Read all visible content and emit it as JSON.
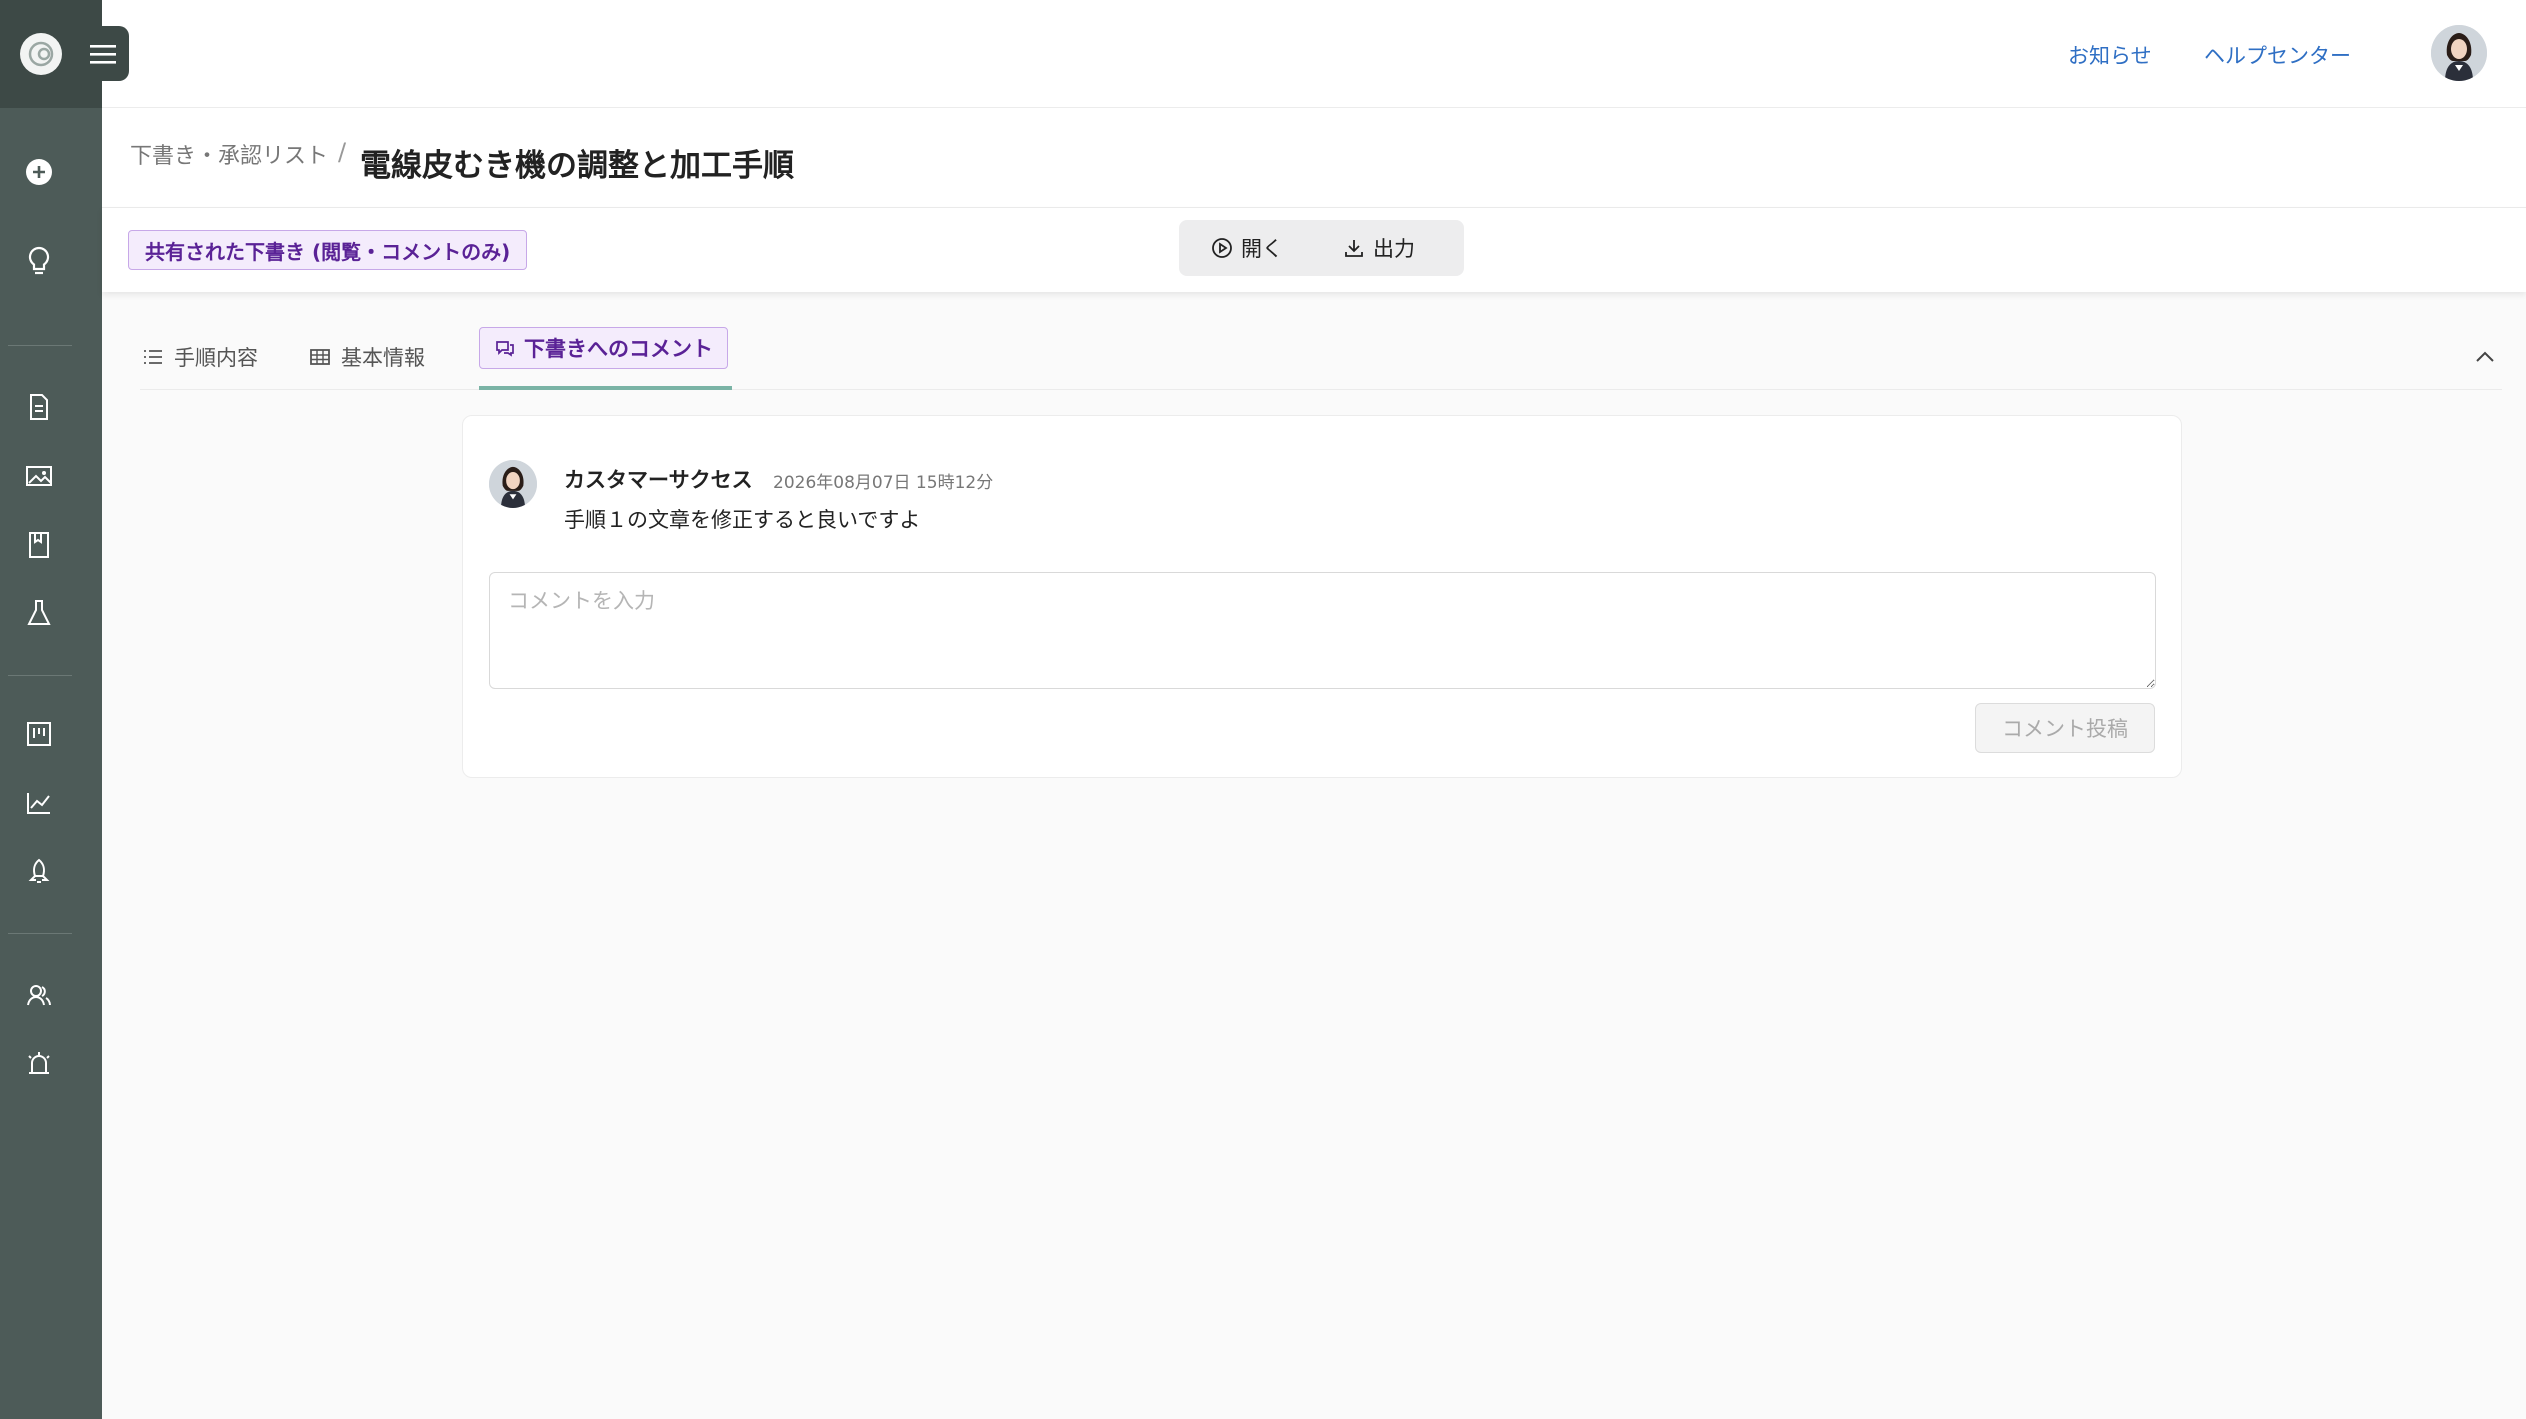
{
  "app": {
    "colors": {
      "sidebar": "#4d5b58",
      "link": "#2f6fc4",
      "badge_text": "#5a2296",
      "badge_bg": "#f4ecfc",
      "tab_underline": "#7ab3a5"
    }
  },
  "sidebar": {
    "logo_icon": "logo-icon",
    "items": [
      {
        "icon": "plus-circle-icon"
      },
      {
        "icon": "lightbulb-icon"
      },
      {
        "icon": "document-icon"
      },
      {
        "icon": "image-icon"
      },
      {
        "icon": "book-icon"
      },
      {
        "icon": "flask-icon"
      },
      {
        "icon": "board-icon"
      },
      {
        "icon": "chart-icon"
      },
      {
        "icon": "rocket-icon"
      },
      {
        "icon": "users-icon"
      },
      {
        "icon": "alarm-icon"
      }
    ]
  },
  "header": {
    "links": [
      "お知らせ",
      "ヘルプセンター"
    ]
  },
  "titlebar": {
    "breadcrumb": "下書き・承認リスト",
    "separator": "/",
    "title": "電線皮むき機の調整と加工手順"
  },
  "actionbar": {
    "badge": "共有された下書き (閲覧・コメントのみ)",
    "open_label": "開く",
    "export_label": "出力"
  },
  "tabs": [
    {
      "label": "手順内容",
      "icon": "list-icon"
    },
    {
      "label": "基本情報",
      "icon": "table-icon"
    },
    {
      "label": "下書きへのコメント",
      "icon": "comment-icon",
      "active": true
    }
  ],
  "comments": [
    {
      "author": "カスタマーサクセス",
      "time": "2026年08月07日 15時12分",
      "text": "手順１の文章を修正すると良いですよ"
    }
  ],
  "comment_form": {
    "placeholder": "コメントを入力",
    "submit_label": "コメント投稿"
  }
}
